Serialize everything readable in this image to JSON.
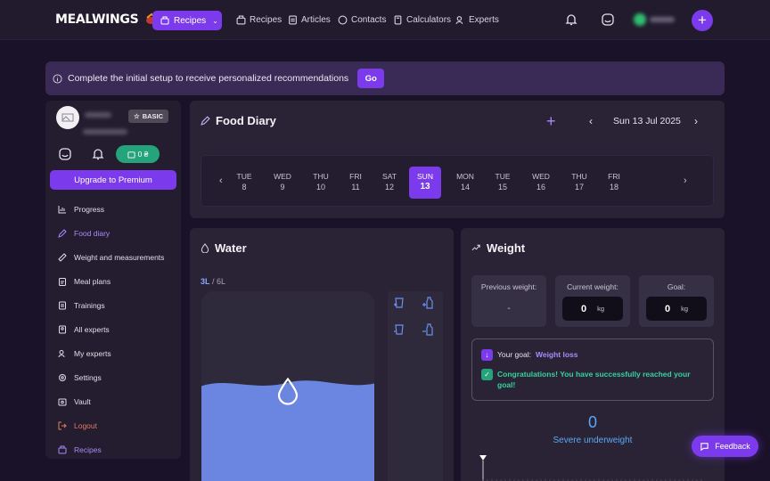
{
  "header": {
    "logo": "MEALWINGS",
    "dropdown_label": "Recipes",
    "nav": [
      {
        "label": "Recipes"
      },
      {
        "label": "Articles"
      },
      {
        "label": "Contacts"
      },
      {
        "label": "Calculators"
      },
      {
        "label": "Experts"
      }
    ],
    "plus": "+"
  },
  "banner": {
    "text": "Complete the initial setup to receive personalized recommendations",
    "button": "Go"
  },
  "sidebar": {
    "plan_badge": "BASIC",
    "wallet": "0 ₴",
    "upgrade": "Upgrade to Premium",
    "menu": [
      {
        "label": "Progress",
        "icon": "chart-icon"
      },
      {
        "label": "Food diary",
        "icon": "pen-icon"
      },
      {
        "label": "Weight and measurements",
        "icon": "ruler-icon"
      },
      {
        "label": "Meal plans",
        "icon": "clipboard-icon"
      },
      {
        "label": "Trainings",
        "icon": "list-icon"
      },
      {
        "label": "All experts",
        "icon": "id-card-icon"
      },
      {
        "label": "My experts",
        "icon": "users-icon"
      },
      {
        "label": "Settings",
        "icon": "gear-icon"
      },
      {
        "label": "Vault",
        "icon": "vault-icon"
      },
      {
        "label": "Logout",
        "icon": "logout-icon"
      },
      {
        "label": "Recipes",
        "icon": "recipes-icon"
      }
    ]
  },
  "food_diary": {
    "title": "Food Diary",
    "date": "Sun 13 Jul 2025",
    "days": [
      {
        "dow": "TUE",
        "num": "8"
      },
      {
        "dow": "WED",
        "num": "9"
      },
      {
        "dow": "THU",
        "num": "10"
      },
      {
        "dow": "FRI",
        "num": "11"
      },
      {
        "dow": "SAT",
        "num": "12"
      },
      {
        "dow": "SUN",
        "num": "13"
      },
      {
        "dow": "MON",
        "num": "14"
      },
      {
        "dow": "TUE",
        "num": "15"
      },
      {
        "dow": "WED",
        "num": "16"
      },
      {
        "dow": "THU",
        "num": "17"
      },
      {
        "dow": "FRI",
        "num": "18"
      }
    ],
    "selected_index": 5
  },
  "water": {
    "title": "Water",
    "current": "3L",
    "target": "/ 6L",
    "fill_fraction": 0.5
  },
  "weight": {
    "title": "Weight",
    "previous_label": "Previous weight:",
    "previous_value": "-",
    "current_label": "Current weight:",
    "current_value": "0",
    "goal_label": "Goal:",
    "goal_value": "0",
    "unit": "kg",
    "goal_text_prefix": "Your goal:",
    "goal_text_value": "Weight loss",
    "congrats": "Congratulations! You have successfully reached your goal!",
    "bmi_value": "0",
    "bmi_category": "Severe underweight"
  },
  "feedback": "Feedback",
  "colors": {
    "accent": "#7c3aed",
    "background": "#1a1228",
    "card": "#2a2336",
    "water": "#6b86e0",
    "success": "#25a37a",
    "bmi": "#5aa8f5"
  }
}
